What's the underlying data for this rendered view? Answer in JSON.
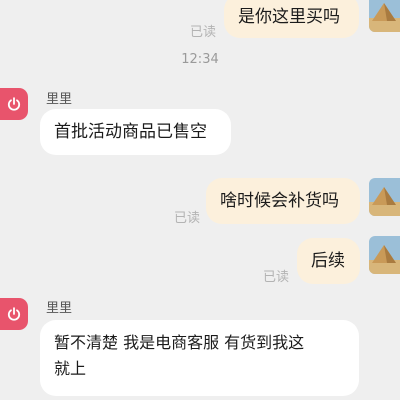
{
  "status": {
    "read": "已读"
  },
  "timestamp": "12:34",
  "bot": {
    "name": "里里",
    "avatar_icon": "power-icon",
    "avatar_color": "#e8546c"
  },
  "messages": [
    {
      "side": "right",
      "text": "是你这里买吗",
      "read": "已读"
    },
    {
      "side": "left",
      "sender": "里里",
      "text": "首批活动商品已售空"
    },
    {
      "side": "right",
      "text": "啥时候会补货吗",
      "read": "已读"
    },
    {
      "side": "right",
      "text": "后续",
      "read": "已读"
    },
    {
      "side": "left",
      "sender": "里里",
      "lines": [
        "暂不清楚 我是电商客服 有货到我这",
        "就上"
      ]
    }
  ],
  "user": {
    "avatar_icon": "pyramids-icon"
  }
}
